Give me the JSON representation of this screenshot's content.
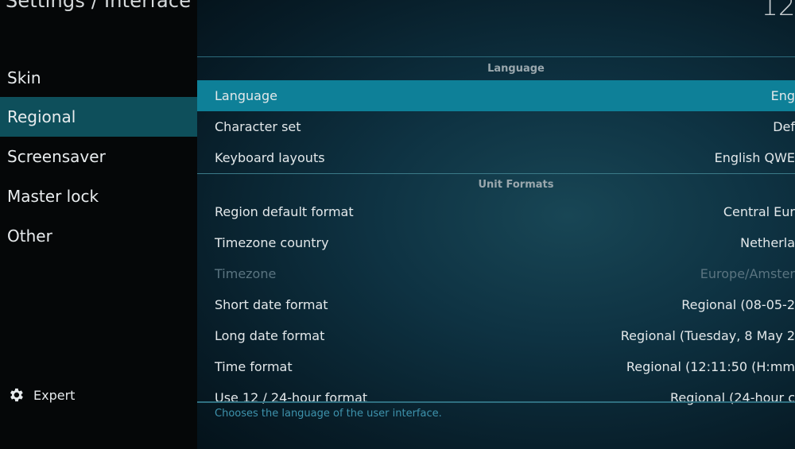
{
  "header": {
    "title": "Settings / Interface",
    "clock": "12:"
  },
  "sidebar": {
    "items": [
      {
        "label": "Skin"
      },
      {
        "label": "Regional"
      },
      {
        "label": "Screensaver"
      },
      {
        "label": "Master lock"
      },
      {
        "label": "Other"
      }
    ],
    "active_item": "Regional",
    "expert_label": "Expert",
    "expert_icon": "gear-icon"
  },
  "sections": {
    "language": {
      "header": "Language",
      "rows": [
        {
          "label": "Language",
          "value": "Eng"
        },
        {
          "label": "Character set",
          "value": "Def"
        },
        {
          "label": "Keyboard layouts",
          "value": "English QWE"
        }
      ]
    },
    "unit_formats": {
      "header": "Unit Formats",
      "rows": [
        {
          "label": "Region default format",
          "value": "Central Eur"
        },
        {
          "label": "Timezone country",
          "value": "Netherla"
        },
        {
          "label": "Timezone",
          "value": "Europe/Amster"
        },
        {
          "label": "Short date format",
          "value": "Regional (08-05-2"
        },
        {
          "label": "Long date format",
          "value": "Regional (Tuesday, 8 May 2"
        },
        {
          "label": "Time format",
          "value": "Regional (12:11:50 (H:mm"
        },
        {
          "label": "Use 12 / 24-hour format",
          "value": "Regional (24-hour c"
        }
      ]
    }
  },
  "help_text": "Chooses the language of the user interface.",
  "colors": {
    "focus": "#0e8098",
    "sidebar_active": "#0e4f5b",
    "help_text": "#3e93ad"
  }
}
